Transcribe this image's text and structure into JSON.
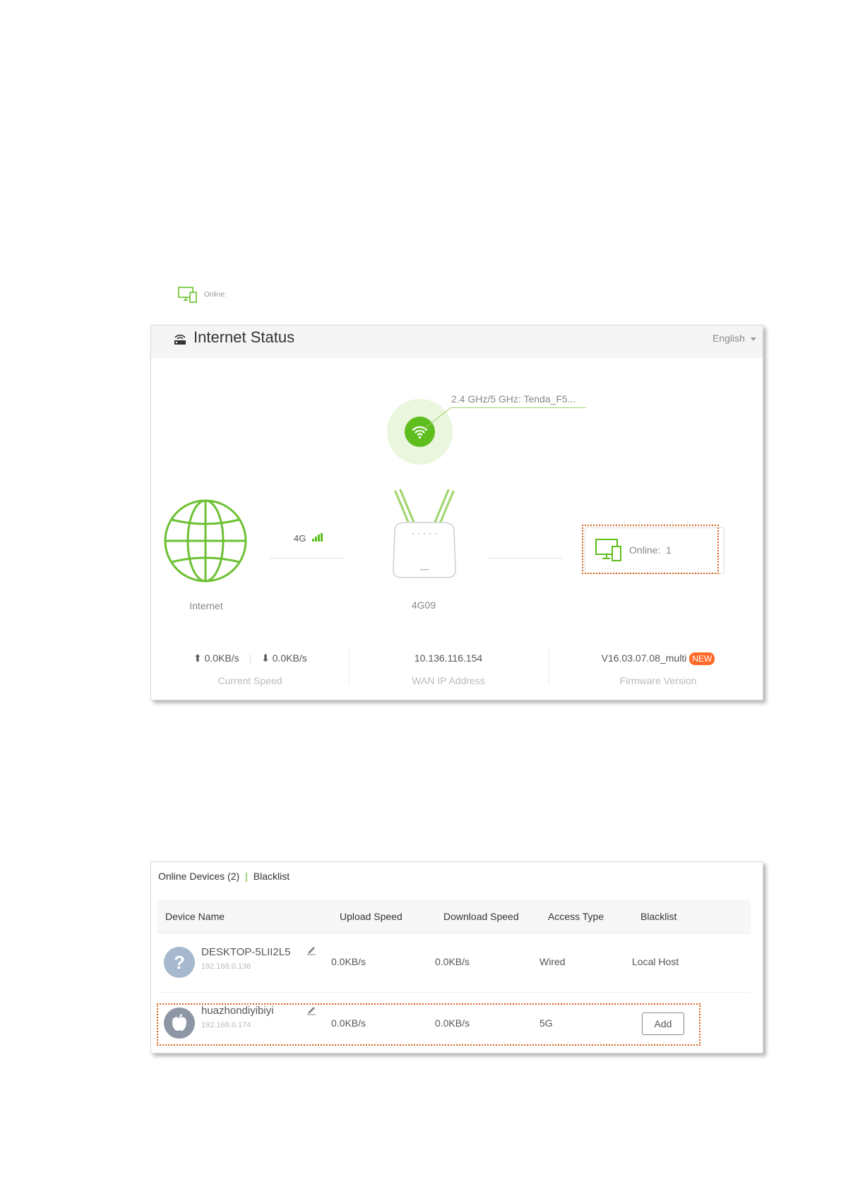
{
  "caption": {
    "text": "Online:",
    "icon": "devices-icon"
  },
  "status_panel": {
    "title": "Internet Status",
    "title_icon": "router-signal-icon",
    "language": "English",
    "ssid": "2.4 GHz/5 GHz: Tenda_F5...",
    "internet_label": "Internet",
    "network_type": "4G",
    "device_label": "4G09",
    "online_label": "Online:",
    "online_count": "1",
    "upload_speed": "0.0KB/s",
    "download_speed": "0.0KB/s",
    "current_speed_label": "Current Speed",
    "wan_ip": "10.136.116.154",
    "wan_label": "WAN IP Address",
    "firmware": "V16.03.07.08_multi",
    "firmware_badge": "NEW",
    "firmware_label": "Firmware Version",
    "accent_color": "#5fbe1e",
    "highlight_color": "#d9601a"
  },
  "devices_panel": {
    "tab_online": "Online Devices (2)",
    "tab_blacklist": "Blacklist",
    "columns": [
      "Device Name",
      "Upload Speed",
      "Download Speed",
      "Access Type",
      "Blacklist"
    ],
    "rows": [
      {
        "name": "DESKTOP-5LII2L5",
        "ip": "192.168.0.136",
        "upload": "0.0KB/s",
        "download": "0.0KB/s",
        "access": "Wired",
        "blacklist": "Local Host",
        "avatar": "question-icon"
      },
      {
        "name": "huazhondiyibiyi",
        "ip": "192.168.0.174",
        "upload": "0.0KB/s",
        "download": "0.0KB/s",
        "access": "5G",
        "blacklist": "Add",
        "avatar": "apple-icon"
      }
    ]
  }
}
